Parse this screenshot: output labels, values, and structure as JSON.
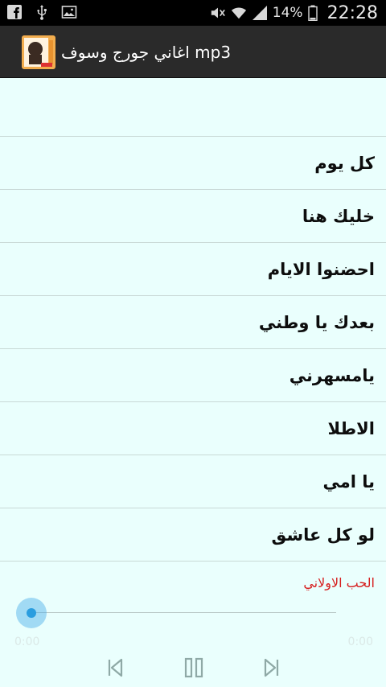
{
  "status_bar": {
    "battery_percent": "14%",
    "time": "22:28",
    "left_icons": [
      "facebook-icon",
      "usb-icon",
      "image-icon"
    ],
    "right_icons": [
      "mute-icon",
      "wifi-icon",
      "signal-icon",
      "battery-icon"
    ]
  },
  "action_bar": {
    "title": "اغاني جورج وسوف mp3",
    "icon": "app-avatar-icon"
  },
  "songs": [
    "كل يوم",
    "خليك هنا",
    "احضنوا الايام",
    "بعدك يا وطني",
    "يامسهرني",
    "الاطلا",
    "يا امي",
    "لو كل عاشق"
  ],
  "player": {
    "now_playing": "الحب الاولاني",
    "current_time": "0:00",
    "total_time": "0:00",
    "progress": 0,
    "accent_color": "#2a9ddf",
    "controls": [
      "previous-icon",
      "pause-icon",
      "next-icon"
    ]
  },
  "colors": {
    "background": "#eafffd",
    "action_bar": "#2a2a2a",
    "now_playing": "#d61f1f"
  }
}
